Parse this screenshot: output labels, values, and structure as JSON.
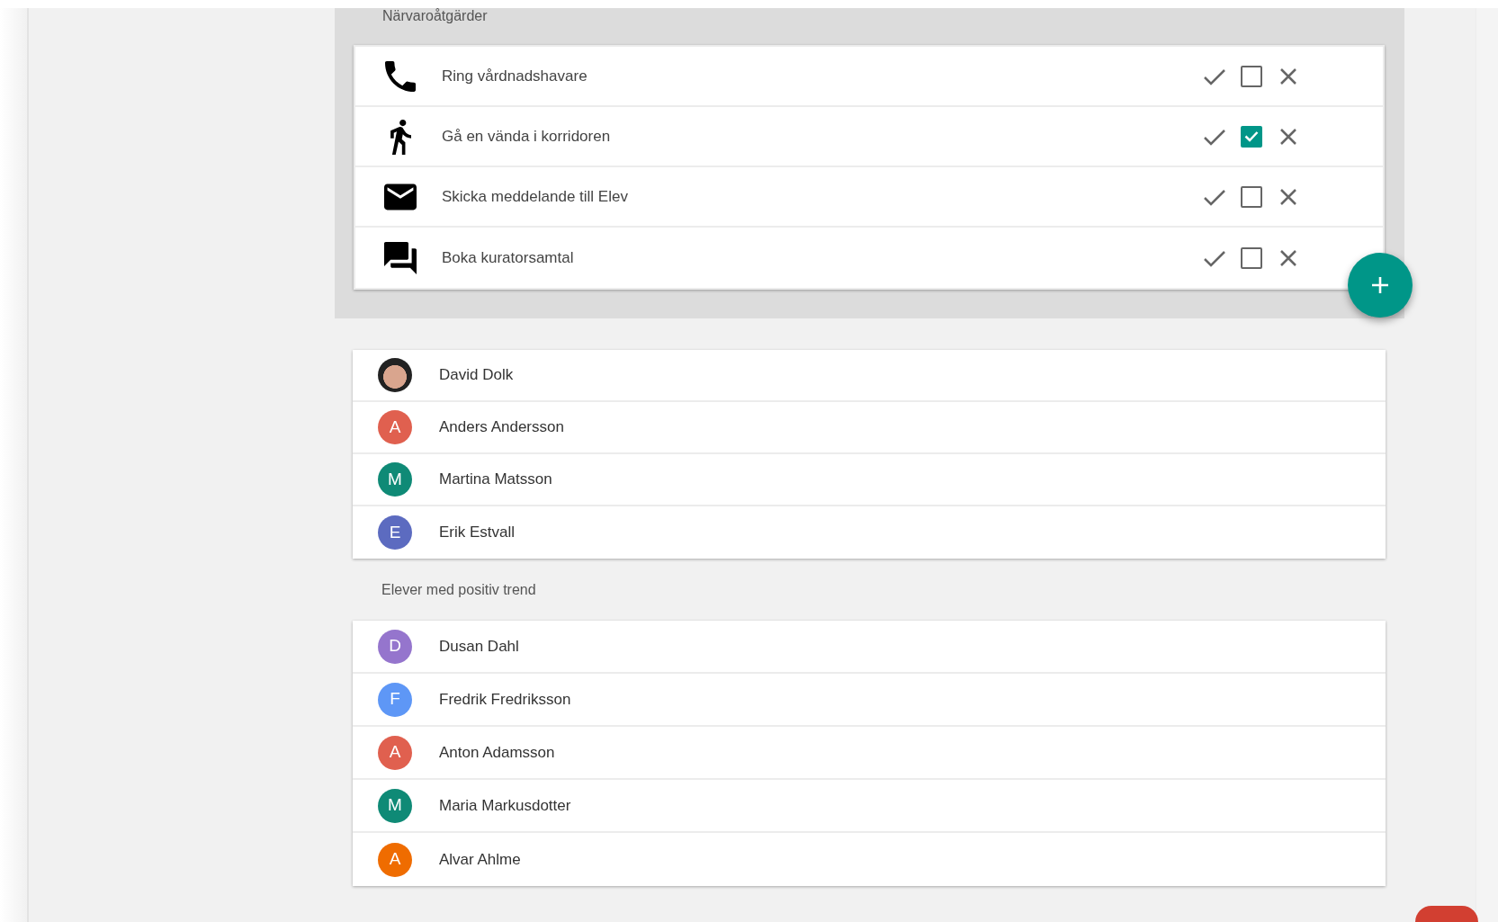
{
  "actions_panel": {
    "title": "Närvaroåtgärder",
    "actions": [
      {
        "label": "Ring vårdnadshavare",
        "checked": false
      },
      {
        "label": "Gå en vända i korridoren",
        "checked": true
      },
      {
        "label": "Skicka meddelande till Elev",
        "checked": false
      },
      {
        "label": "Boka kuratorsamtal",
        "checked": false
      }
    ]
  },
  "students": [
    {
      "kind": "photo",
      "name": "David Dolk"
    },
    {
      "kind": "initial",
      "initial": "A",
      "color": "#e0604f",
      "name": "Anders Andersson"
    },
    {
      "kind": "initial",
      "initial": "M",
      "color": "#0f8a76",
      "name": "Martina Matsson"
    },
    {
      "kind": "initial",
      "initial": "E",
      "color": "#5c6bc0",
      "name": "Erik Estvall"
    }
  ],
  "positive_trend": {
    "title": "Elever med positiv trend",
    "students": [
      {
        "kind": "initial",
        "initial": "D",
        "color": "#9575cd",
        "name": "Dusan Dahl"
      },
      {
        "kind": "initial",
        "initial": "F",
        "color": "#5e97f6",
        "name": "Fredrik Fredriksson"
      },
      {
        "kind": "initial",
        "initial": "A",
        "color": "#e0604f",
        "name": "Anton Adamsson"
      },
      {
        "kind": "initial",
        "initial": "M",
        "color": "#0f8a76",
        "name": "Maria Markusdotter"
      },
      {
        "kind": "initial",
        "initial": "A",
        "color": "#ef6c00",
        "name": "Alvar Ahlme"
      }
    ]
  }
}
